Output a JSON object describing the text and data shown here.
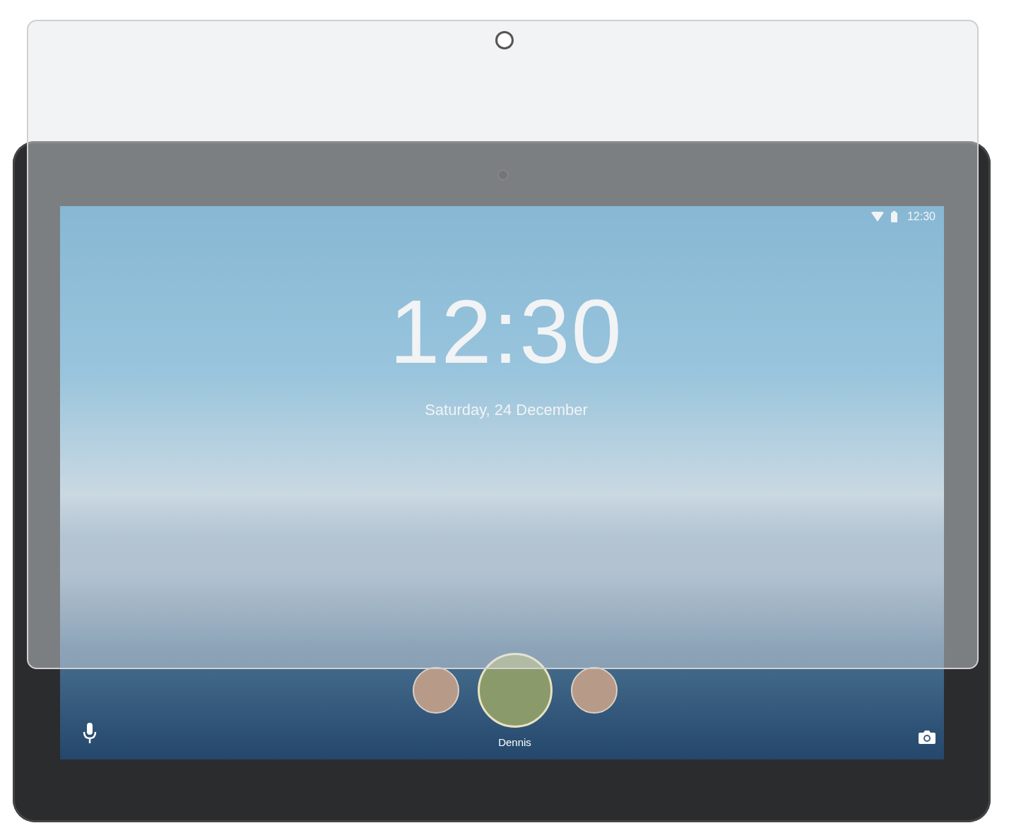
{
  "status_bar": {
    "time": "12:30"
  },
  "clock": {
    "time": "12:30",
    "date": "Saturday, 24 December"
  },
  "users": [
    {
      "selected": false
    },
    {
      "name": "Dennis",
      "selected": true
    },
    {
      "selected": false
    }
  ]
}
